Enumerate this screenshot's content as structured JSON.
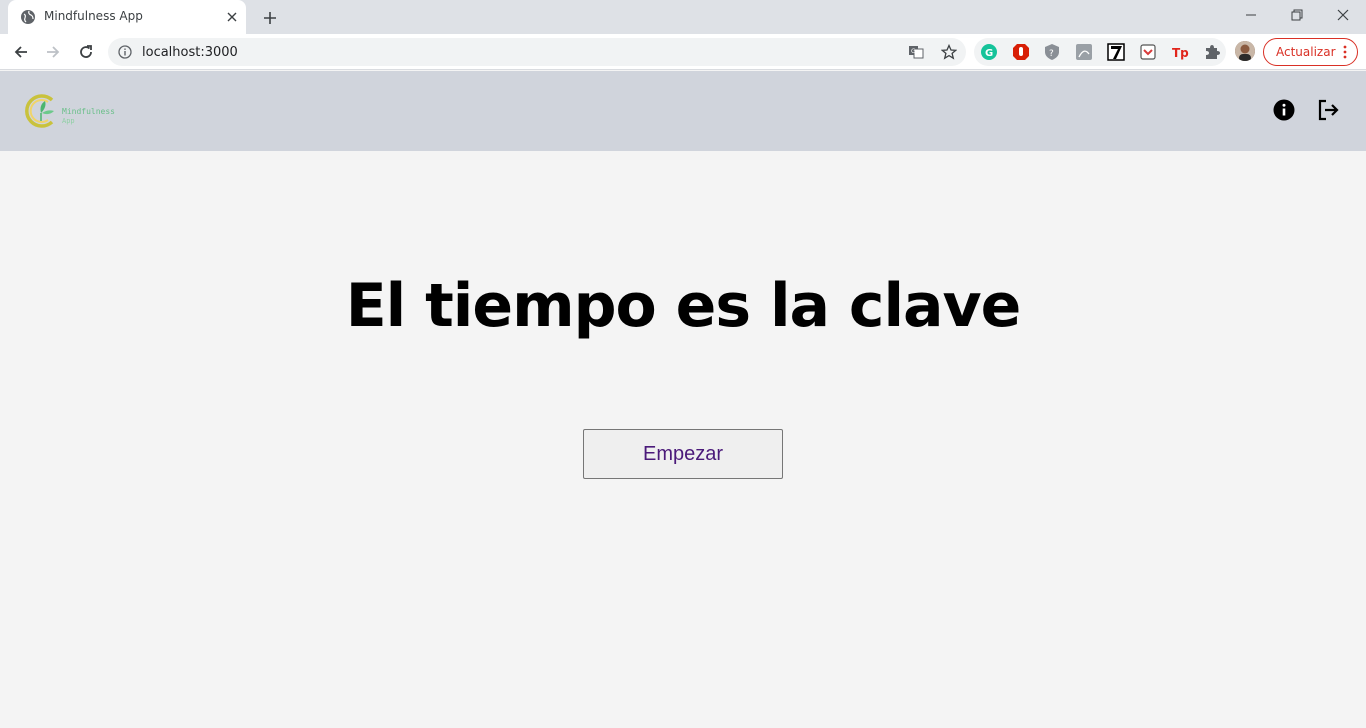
{
  "browser": {
    "tab_title": "Mindfulness App",
    "url": "localhost:3000",
    "update_label": "Actualizar",
    "colors": {
      "tabstrip": "#dee1e6",
      "update_red": "#d93025"
    }
  },
  "app": {
    "logo": {
      "line1": "Mindfulness",
      "line2": "App"
    },
    "headline": "El tiempo es la clave",
    "start_button": "Empezar",
    "colors": {
      "header_bg": "#d0d4dc",
      "page_bg": "#f4f4f4",
      "button_text": "#4b1a7a"
    }
  },
  "icons": {
    "header": [
      "info-icon",
      "logout-icon"
    ],
    "extensions": [
      "grammarly-icon",
      "adblock-icon",
      "privacy-icon",
      "pdf-icon",
      "notion-icon",
      "pocket-icon",
      "tp-icon",
      "puzzle-icon"
    ]
  }
}
